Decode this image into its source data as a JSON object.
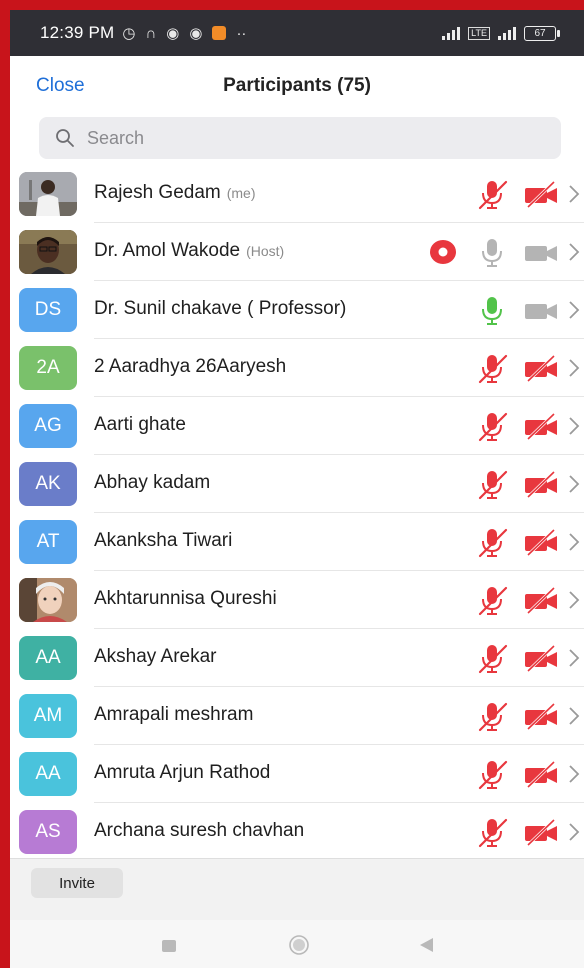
{
  "status_bar": {
    "time": "12:39 PM",
    "network_badge": "LTE",
    "battery": "67",
    "icons": [
      "alarm-icon",
      "headphones-icon",
      "chrome-icon",
      "chrome-icon",
      "app-notification-icon",
      "more-dots-icon"
    ]
  },
  "header": {
    "close_label": "Close",
    "title": "Participants (75)"
  },
  "search": {
    "placeholder": "Search"
  },
  "participants": [
    {
      "name": "Rajesh Gedam",
      "role": "(me)",
      "initials": "",
      "avatar_color": "#9a9a9a",
      "photo": "photo-man-1",
      "mic": "muted",
      "video": "off"
    },
    {
      "name": "Dr. Amol Wakode",
      "role": "(Host)",
      "initials": "",
      "avatar_color": "#5a4a3a",
      "photo": "photo-man-2",
      "mic": "available",
      "video": "available",
      "recording": true
    },
    {
      "name": "Dr. Sunil chakave ( Professor)",
      "role": "",
      "initials": "DS",
      "avatar_color": "#58a6ee",
      "mic": "active",
      "video": "available"
    },
    {
      "name": "2 Aaradhya 26Aaryesh",
      "role": "",
      "initials": "2A",
      "avatar_color": "#7ac16b",
      "mic": "muted",
      "video": "off"
    },
    {
      "name": "Aarti ghate",
      "role": "",
      "initials": "AG",
      "avatar_color": "#58a6ee",
      "mic": "muted",
      "video": "off"
    },
    {
      "name": "Abhay kadam",
      "role": "",
      "initials": "AK",
      "avatar_color": "#6a7dc9",
      "mic": "muted",
      "video": "off"
    },
    {
      "name": "Akanksha Tiwari",
      "role": "",
      "initials": "AT",
      "avatar_color": "#58a6ee",
      "mic": "muted",
      "video": "off"
    },
    {
      "name": "Akhtarunnisa Qureshi",
      "role": "",
      "initials": "",
      "avatar_color": "#c9a58a",
      "photo": "photo-child",
      "mic": "muted",
      "video": "off"
    },
    {
      "name": "Akshay Arekar",
      "role": "",
      "initials": "AA",
      "avatar_color": "#3fb1a3",
      "mic": "muted",
      "video": "off"
    },
    {
      "name": "Amrapali meshram",
      "role": "",
      "initials": "AM",
      "avatar_color": "#4ac3dc",
      "mic": "muted",
      "video": "off"
    },
    {
      "name": "Amruta Arjun Rathod",
      "role": "",
      "initials": "AA",
      "avatar_color": "#4ac3dc",
      "mic": "muted",
      "video": "off"
    },
    {
      "name": "Archana suresh chavhan",
      "role": "",
      "initials": "AS",
      "avatar_color": "#b77bd4",
      "mic": "muted",
      "video": "off"
    }
  ],
  "footer": {
    "invite_label": "Invite"
  },
  "colors": {
    "accent": "#1f6fd8",
    "muted_red": "#e8373e",
    "active_green": "#52c34a",
    "idle_gray": "#b4b4b4",
    "frame_red": "#c8141b"
  }
}
